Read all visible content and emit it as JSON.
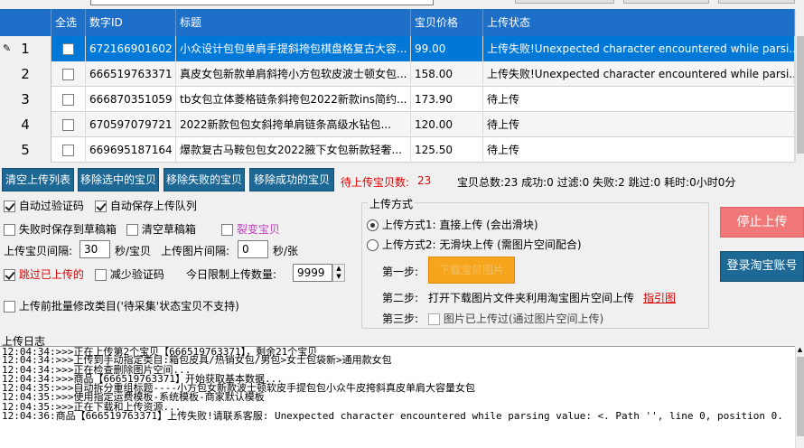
{
  "grid": {
    "headers": [
      "全选",
      "数字ID",
      "标题",
      "宝贝价格",
      "上传状态"
    ],
    "rows": [
      {
        "num": "1",
        "id": "672166901602",
        "title": "小众设计包包单肩手提斜挎包棋盘格复古大容...",
        "price": "99.00",
        "status": "上传失败!Unexpected character encountered while parsi..."
      },
      {
        "num": "2",
        "id": "666519763371",
        "title": "真皮女包新款单肩斜挎小方包软皮波士顿女包...",
        "price": "158.00",
        "status": "上传失败!Unexpected character encountered while parsi..."
      },
      {
        "num": "3",
        "id": "666870351059",
        "title": "tb女包立体菱格链条斜挎包2022新款ins简约...",
        "price": "173.90",
        "status": "待上传"
      },
      {
        "num": "4",
        "id": "670597079721",
        "title": "2022新款包包女斜挎单肩链条高级水钻包...",
        "price": "120.00",
        "status": "待上传"
      },
      {
        "num": "5",
        "id": "669695187164",
        "title": "爆款复古马鞍包包女2022腋下女包新款轻奢...",
        "price": "125.50",
        "status": "待上传"
      }
    ]
  },
  "buttons": {
    "clear_list": "清空上传列表",
    "remove_selected": "移除选中的宝贝",
    "remove_failed": "移除失败的宝贝",
    "remove_success": "移除成功的宝贝",
    "stop_upload": "停止上传",
    "login_taobao": "登录淘宝账号",
    "download_images": "下载宝贝图片"
  },
  "stats": {
    "pending_label": "待上传宝贝数:",
    "pending_value": "23",
    "summary": "宝贝总数:23  成功:0 过滤:0 失败:2 跳过:0 耗时:0小时0分"
  },
  "options": {
    "auto_captcha": "自动过验证码",
    "auto_save_queue": "自动保存上传队列",
    "save_draft_on_fail": "失败时保存到草稿箱",
    "clear_draft": "清空草稿箱",
    "fission_item": "裂变宝贝",
    "upload_interval_label": "上传宝贝间隔:",
    "upload_interval_value": "30",
    "upload_interval_unit": "秒/宝贝",
    "image_interval_label": "上传图片间隔:",
    "image_interval_value": "0",
    "image_interval_unit": "秒/张",
    "skip_uploaded": "跳过已上传的",
    "reduce_captcha": "减少验证码",
    "daily_limit_label": "今日限制上传数量:",
    "daily_limit_value": "9999",
    "batch_modify_category": "上传前批量修改类目('待采集'状态宝贝不支持)"
  },
  "upload_method": {
    "legend": "上传方式",
    "method1": "上传方式1: 直接上传 (会出滑块)",
    "method2": "上传方式2: 无滑块上传 (需图片空间配合)",
    "step1": "第一步:",
    "step2": "第二步:",
    "step2_text": "打开下载图片文件夹利用淘宝图片空间上传",
    "step2_link": "指引图",
    "step3": "第三步:",
    "step3_text": "图片已上传过(通过图片空间上传)"
  },
  "log": {
    "title": "上传日志",
    "lines": [
      "12:04:34:>>>正在上传第2个宝贝【666519763371】，剩余21个宝贝",
      "12:04:34:>>>上传到手动指定类目:箱包皮具/热销女包/男包>女士包袋新>通用款女包",
      "12:04:34:>>>正在检查删除图片空间...",
      "12:04:34:>>>商品【666519763371】开始获取基本数据...",
      "12:04:35:>>>自动拆分重组标题----小方包女新款波士顿软皮手提包包小众牛皮挎斜真皮单肩大容量女包",
      "12:04:35:>>>使用指定运费模板-系统模板-商家默认模板",
      "12:04:35:>>>正在下载和上传资源...",
      "12:04:36:商品【666519763371】上传失败!请联系客服: Unexpected character encountered while parsing value: <. Path '', line 0, position 0."
    ]
  },
  "colors": {
    "header_blue": "#1e6fc8",
    "selected_row": "#0078d7",
    "action_blue": "#1e6896",
    "stop_red": "#f07878",
    "download_orange": "#f7a41d",
    "danger_text": "#e00000"
  }
}
